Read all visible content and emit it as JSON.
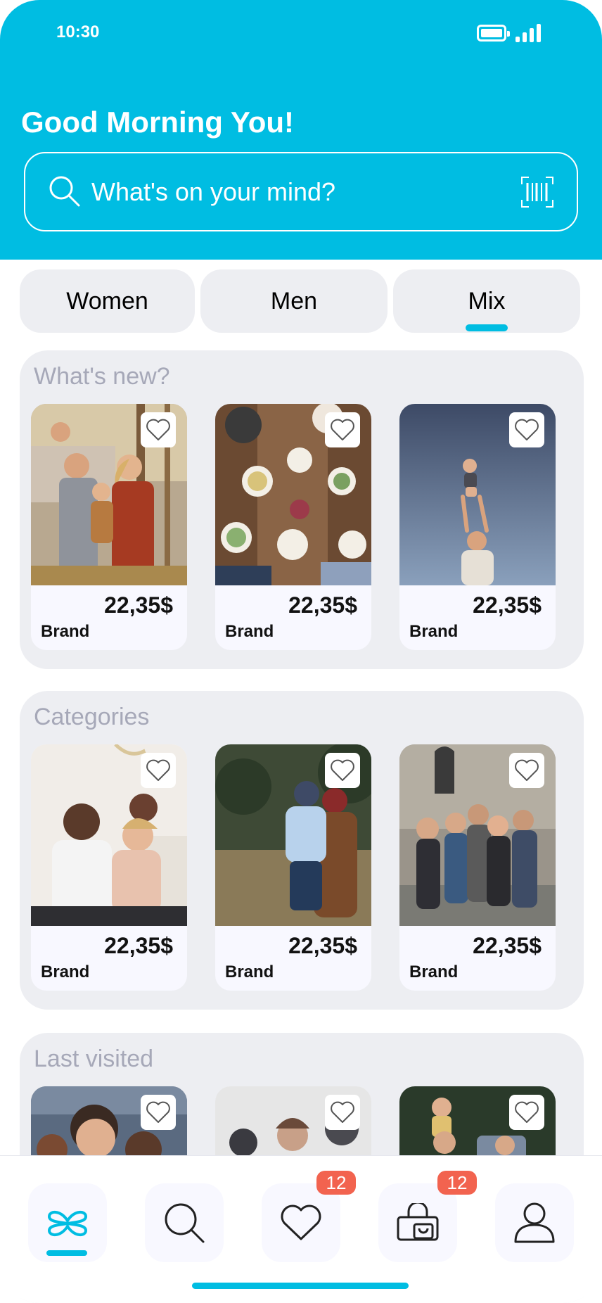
{
  "status_bar": {
    "time": "10:30"
  },
  "header": {
    "greeting": "Good Morning You!",
    "search_placeholder": "What's on your mind?"
  },
  "tabs": [
    {
      "label": "Women",
      "selected": false
    },
    {
      "label": "Men",
      "selected": false
    },
    {
      "label": "Mix",
      "selected": true
    }
  ],
  "sections": {
    "whats_new": {
      "title": "What's new?",
      "cards": [
        {
          "price": "22,35$",
          "brand": "Brand",
          "image": "family-photo"
        },
        {
          "price": "22,35$",
          "brand": "Brand",
          "image": "dinner-table-photo"
        },
        {
          "price": "22,35$",
          "brand": "Brand",
          "image": "baby-toss-photo"
        }
      ]
    },
    "categories": {
      "title": "Categories",
      "cards": [
        {
          "price": "22,35$",
          "brand": "Brand",
          "image": "family-couch-photo"
        },
        {
          "price": "22,35$",
          "brand": "Brand",
          "image": "child-hug-photo"
        },
        {
          "price": "22,35$",
          "brand": "Brand",
          "image": "friends-group-photo"
        }
      ]
    },
    "last_visited": {
      "title": "Last visited",
      "cards": [
        {
          "price": "",
          "brand": "",
          "image": "portrait-photo"
        },
        {
          "price": "",
          "brand": "",
          "image": "snow-photo"
        },
        {
          "price": "",
          "brand": "",
          "image": "park-photo"
        }
      ]
    }
  },
  "bottom_nav": {
    "items": [
      {
        "icon": "home-logo-icon",
        "active": true
      },
      {
        "icon": "search-icon",
        "active": false
      },
      {
        "icon": "heart-icon",
        "active": false,
        "badge": "12"
      },
      {
        "icon": "shopping-bag-icon",
        "active": false,
        "badge": "12"
      },
      {
        "icon": "profile-icon",
        "active": false
      }
    ]
  },
  "colors": {
    "accent": "#00bde2",
    "badge": "#f2634f",
    "section_bg": "#edeef2",
    "card_bg": "#f8f8ff",
    "section_title": "#a6a8b8"
  }
}
